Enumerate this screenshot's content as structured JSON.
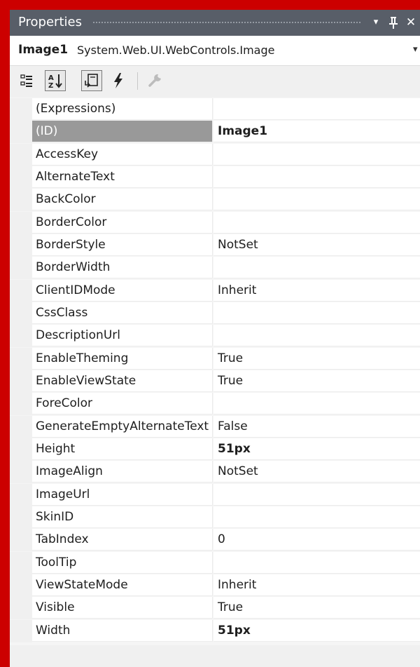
{
  "window": {
    "title": "Properties",
    "dropdown_glyph": "▾",
    "pin_glyph": "ǂ",
    "close_glyph": "✕"
  },
  "object_selector": {
    "name": "Image1",
    "type": "System.Web.UI.WebControls.Image"
  },
  "toolbar": {
    "buttons": [
      {
        "icon": "categorized-icon",
        "checked": false
      },
      {
        "icon": "alphabetical-sort-icon",
        "checked": true
      },
      {
        "icon": "properties-icon",
        "checked": true
      },
      {
        "icon": "events-lightning-icon",
        "checked": false
      },
      {
        "icon": "property-pages-wrench-icon",
        "checked": false,
        "disabled": true
      }
    ]
  },
  "properties": [
    {
      "name": "(Expressions)",
      "value": "",
      "bold": false
    },
    {
      "name": "(ID)",
      "value": "Image1",
      "bold": true,
      "selected": true
    },
    {
      "name": "AccessKey",
      "value": "",
      "bold": false
    },
    {
      "name": "AlternateText",
      "value": "",
      "bold": false
    },
    {
      "name": "BackColor",
      "value": "",
      "bold": false
    },
    {
      "name": "BorderColor",
      "value": "",
      "bold": false
    },
    {
      "name": "BorderStyle",
      "value": "NotSet",
      "bold": false
    },
    {
      "name": "BorderWidth",
      "value": "",
      "bold": false
    },
    {
      "name": "ClientIDMode",
      "value": "Inherit",
      "bold": false
    },
    {
      "name": "CssClass",
      "value": "",
      "bold": false
    },
    {
      "name": "DescriptionUrl",
      "value": "",
      "bold": false
    },
    {
      "name": "EnableTheming",
      "value": "True",
      "bold": false
    },
    {
      "name": "EnableViewState",
      "value": "True",
      "bold": false
    },
    {
      "name": "ForeColor",
      "value": "",
      "bold": false
    },
    {
      "name": "GenerateEmptyAlternateText",
      "value": "False",
      "bold": false
    },
    {
      "name": "Height",
      "value": "51px",
      "bold": true
    },
    {
      "name": "ImageAlign",
      "value": "NotSet",
      "bold": false
    },
    {
      "name": "ImageUrl",
      "value": "",
      "bold": false
    },
    {
      "name": "SkinID",
      "value": "",
      "bold": false
    },
    {
      "name": "TabIndex",
      "value": "0",
      "bold": false
    },
    {
      "name": "ToolTip",
      "value": "",
      "bold": false
    },
    {
      "name": "ViewStateMode",
      "value": "Inherit",
      "bold": false
    },
    {
      "name": "Visible",
      "value": "True",
      "bold": false
    },
    {
      "name": "Width",
      "value": "51px",
      "bold": true
    }
  ],
  "colors": {
    "frame": "#cc0000",
    "titlebar": "#585e68",
    "selected_row": "#999999"
  }
}
